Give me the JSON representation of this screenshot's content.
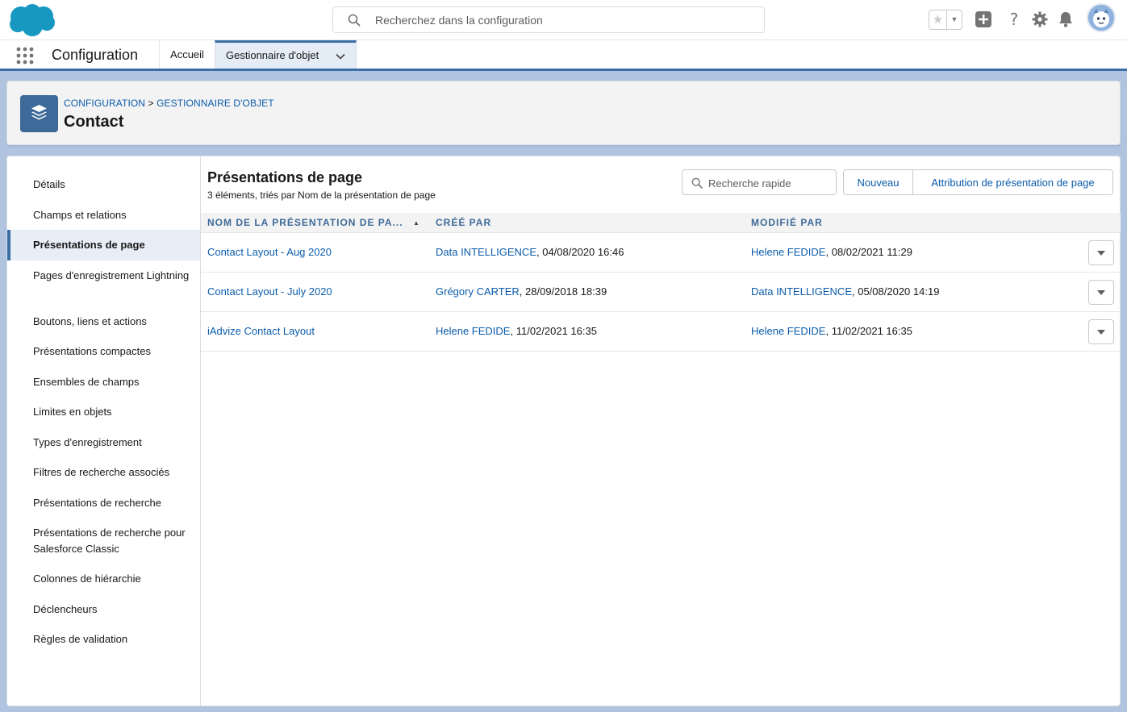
{
  "header": {
    "search_placeholder": "Recherchez dans la configuration"
  },
  "context_bar": {
    "app_name": "Configuration",
    "tabs": [
      {
        "label": "Accueil"
      },
      {
        "label": "Gestionnaire d'objet"
      }
    ]
  },
  "page_header": {
    "breadcrumb_1": "CONFIGURATION",
    "breadcrumb_sep": ">",
    "breadcrumb_2": "GESTIONNAIRE D'OBJET",
    "title": "Contact"
  },
  "sidebar": {
    "items": [
      {
        "label": "Détails"
      },
      {
        "label": "Champs et relations"
      },
      {
        "label": "Présentations de page"
      },
      {
        "label": "Pages d'enregistrement Lightning"
      },
      {
        "label": "Boutons, liens et actions"
      },
      {
        "label": "Présentations compactes"
      },
      {
        "label": "Ensembles de champs"
      },
      {
        "label": "Limites en objets"
      },
      {
        "label": "Types d'enregistrement"
      },
      {
        "label": "Filtres de recherche associés"
      },
      {
        "label": "Présentations de recherche"
      },
      {
        "label": "Présentations de recherche pour Salesforce Classic"
      },
      {
        "label": "Colonnes de hiérarchie"
      },
      {
        "label": "Déclencheurs"
      },
      {
        "label": "Règles de validation"
      }
    ]
  },
  "section": {
    "title": "Présentations de page",
    "subtitle": "3 éléments, triés par Nom de la présentation de page",
    "quick_search_placeholder": "Recherche rapide",
    "new_button": "Nouveau",
    "assign_button": "Attribution de présentation de page"
  },
  "table": {
    "columns": [
      "NOM DE LA PRÉSENTATION DE PA...",
      "CRÉÉ PAR",
      "MODIFIÉ PAR"
    ],
    "rows": [
      {
        "name": "Contact Layout - Aug 2020",
        "created_by": "Data INTELLIGENCE",
        "created_at": ", 04/08/2020 16:46",
        "modified_by": "Helene FEDIDE",
        "modified_at": ", 08/02/2021 11:29"
      },
      {
        "name": "Contact Layout - July 2020",
        "created_by": "Grégory CARTER",
        "created_at": ", 28/09/2018 18:39",
        "modified_by": "Data INTELLIGENCE",
        "modified_at": ", 05/08/2020 14:19"
      },
      {
        "name": "iAdvize Contact Layout",
        "created_by": "Helene FEDIDE",
        "created_at": ", 11/02/2021 16:35",
        "modified_by": "Helene FEDIDE",
        "modified_at": ", 11/02/2021 16:35"
      }
    ]
  },
  "colors": {
    "brand_blue": "#0b5cab",
    "header_accent": "#3b6ea5",
    "object_icon": "#3e6a99",
    "salesforce_cloud": "#1798c1",
    "page_background": "#b0c4df"
  }
}
